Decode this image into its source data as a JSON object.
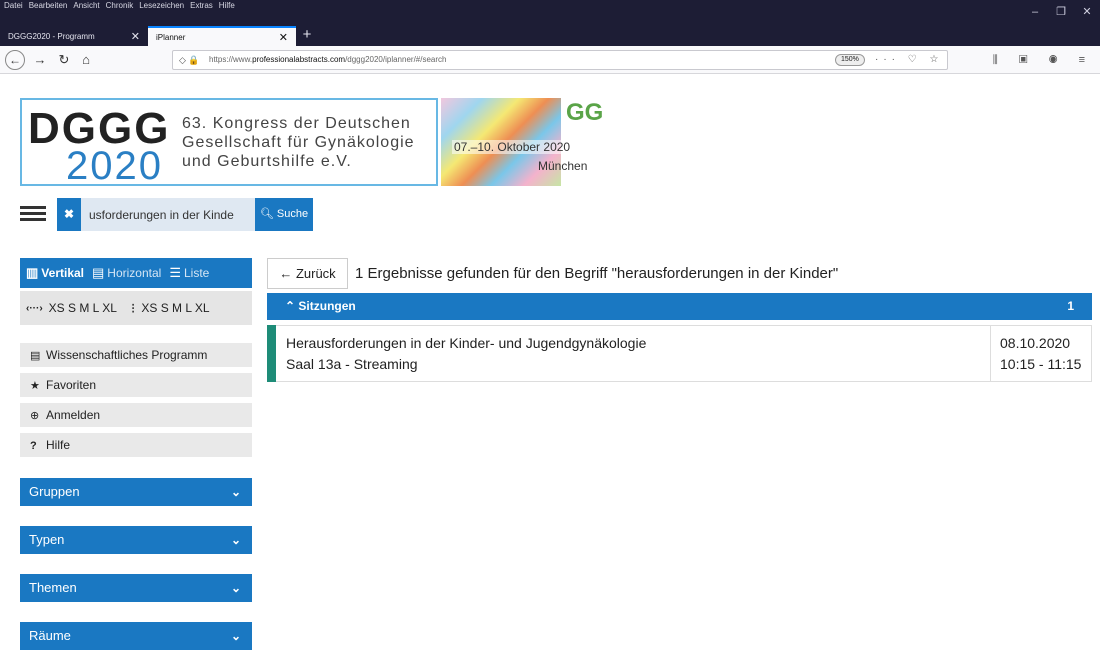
{
  "browser": {
    "menu": [
      "Datei",
      "Bearbeiten",
      "Ansicht",
      "Chronik",
      "Lesezeichen",
      "Extras",
      "Hilfe"
    ],
    "tabs": [
      {
        "label": "DGGG2020 - Programm"
      },
      {
        "label": "iPlanner"
      }
    ],
    "url": {
      "prefix": "https://www.",
      "domain": "professionalabstracts.com",
      "path": "/dggg2020/iplanner/#/search"
    },
    "zoom": "150%"
  },
  "banner": {
    "acronym": "DGGG",
    "year": "2020",
    "congress_lines": [
      "63. Kongress der Deutschen",
      "Gesellschaft für Gynäkologie",
      "und Geburtshilfe e.V."
    ],
    "dates": "07.–10. Oktober 2020",
    "city": "München",
    "logo": "GG"
  },
  "search": {
    "value": "usforderungen in der Kinde",
    "button_label": "Suche"
  },
  "sidebar": {
    "views": {
      "vertical": "Vertikal",
      "horizontal": "Horizontal",
      "list": "Liste"
    },
    "sizes": {
      "width_label": "XS S M L XL",
      "height_label": "XS S M L XL"
    },
    "menu": [
      {
        "label": "Wissenschaftliches Programm",
        "icon": "document-icon"
      },
      {
        "label": "Favoriten",
        "icon": "star-icon"
      },
      {
        "label": "Anmelden",
        "icon": "login-icon"
      },
      {
        "label": "Hilfe",
        "icon": "help-icon"
      }
    ],
    "filters": [
      "Gruppen",
      "Typen",
      "Themen",
      "Räume"
    ]
  },
  "results": {
    "back_label": "Zurück",
    "summary": "1 Ergebnisse gefunden für den Begriff \"herausforderungen in der Kinder\"",
    "section_title": "Sitzungen",
    "section_count": "1",
    "sessions": [
      {
        "title": "Herausforderungen in der Kinder- und Jugendgynäkologie",
        "room": "Saal 13a - Streaming",
        "date": "08.10.2020",
        "time": "10:15 - 11:15"
      }
    ]
  },
  "colors": {
    "primary": "#1a78c2",
    "accent_session": "#1e8c78",
    "browser_frame": "#1d1d35"
  }
}
